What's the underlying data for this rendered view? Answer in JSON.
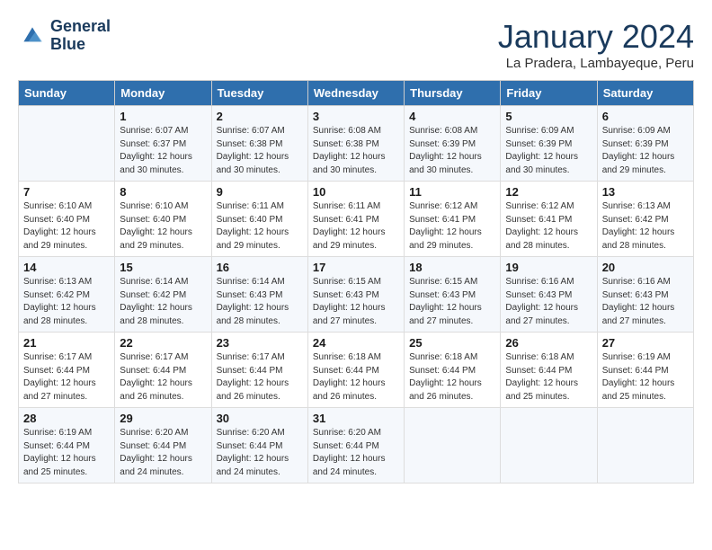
{
  "header": {
    "logo_line1": "General",
    "logo_line2": "Blue",
    "month": "January 2024",
    "location": "La Pradera, Lambayeque, Peru"
  },
  "days_of_week": [
    "Sunday",
    "Monday",
    "Tuesday",
    "Wednesday",
    "Thursday",
    "Friday",
    "Saturday"
  ],
  "weeks": [
    [
      {
        "day": "",
        "sunrise": "",
        "sunset": "",
        "daylight": ""
      },
      {
        "day": "1",
        "sunrise": "6:07 AM",
        "sunset": "6:37 PM",
        "daylight": "12 hours and 30 minutes."
      },
      {
        "day": "2",
        "sunrise": "6:07 AM",
        "sunset": "6:38 PM",
        "daylight": "12 hours and 30 minutes."
      },
      {
        "day": "3",
        "sunrise": "6:08 AM",
        "sunset": "6:38 PM",
        "daylight": "12 hours and 30 minutes."
      },
      {
        "day": "4",
        "sunrise": "6:08 AM",
        "sunset": "6:39 PM",
        "daylight": "12 hours and 30 minutes."
      },
      {
        "day": "5",
        "sunrise": "6:09 AM",
        "sunset": "6:39 PM",
        "daylight": "12 hours and 30 minutes."
      },
      {
        "day": "6",
        "sunrise": "6:09 AM",
        "sunset": "6:39 PM",
        "daylight": "12 hours and 29 minutes."
      }
    ],
    [
      {
        "day": "7",
        "sunrise": "6:10 AM",
        "sunset": "6:40 PM",
        "daylight": "12 hours and 29 minutes."
      },
      {
        "day": "8",
        "sunrise": "6:10 AM",
        "sunset": "6:40 PM",
        "daylight": "12 hours and 29 minutes."
      },
      {
        "day": "9",
        "sunrise": "6:11 AM",
        "sunset": "6:40 PM",
        "daylight": "12 hours and 29 minutes."
      },
      {
        "day": "10",
        "sunrise": "6:11 AM",
        "sunset": "6:41 PM",
        "daylight": "12 hours and 29 minutes."
      },
      {
        "day": "11",
        "sunrise": "6:12 AM",
        "sunset": "6:41 PM",
        "daylight": "12 hours and 29 minutes."
      },
      {
        "day": "12",
        "sunrise": "6:12 AM",
        "sunset": "6:41 PM",
        "daylight": "12 hours and 28 minutes."
      },
      {
        "day": "13",
        "sunrise": "6:13 AM",
        "sunset": "6:42 PM",
        "daylight": "12 hours and 28 minutes."
      }
    ],
    [
      {
        "day": "14",
        "sunrise": "6:13 AM",
        "sunset": "6:42 PM",
        "daylight": "12 hours and 28 minutes."
      },
      {
        "day": "15",
        "sunrise": "6:14 AM",
        "sunset": "6:42 PM",
        "daylight": "12 hours and 28 minutes."
      },
      {
        "day": "16",
        "sunrise": "6:14 AM",
        "sunset": "6:43 PM",
        "daylight": "12 hours and 28 minutes."
      },
      {
        "day": "17",
        "sunrise": "6:15 AM",
        "sunset": "6:43 PM",
        "daylight": "12 hours and 27 minutes."
      },
      {
        "day": "18",
        "sunrise": "6:15 AM",
        "sunset": "6:43 PM",
        "daylight": "12 hours and 27 minutes."
      },
      {
        "day": "19",
        "sunrise": "6:16 AM",
        "sunset": "6:43 PM",
        "daylight": "12 hours and 27 minutes."
      },
      {
        "day": "20",
        "sunrise": "6:16 AM",
        "sunset": "6:43 PM",
        "daylight": "12 hours and 27 minutes."
      }
    ],
    [
      {
        "day": "21",
        "sunrise": "6:17 AM",
        "sunset": "6:44 PM",
        "daylight": "12 hours and 27 minutes."
      },
      {
        "day": "22",
        "sunrise": "6:17 AM",
        "sunset": "6:44 PM",
        "daylight": "12 hours and 26 minutes."
      },
      {
        "day": "23",
        "sunrise": "6:17 AM",
        "sunset": "6:44 PM",
        "daylight": "12 hours and 26 minutes."
      },
      {
        "day": "24",
        "sunrise": "6:18 AM",
        "sunset": "6:44 PM",
        "daylight": "12 hours and 26 minutes."
      },
      {
        "day": "25",
        "sunrise": "6:18 AM",
        "sunset": "6:44 PM",
        "daylight": "12 hours and 26 minutes."
      },
      {
        "day": "26",
        "sunrise": "6:18 AM",
        "sunset": "6:44 PM",
        "daylight": "12 hours and 25 minutes."
      },
      {
        "day": "27",
        "sunrise": "6:19 AM",
        "sunset": "6:44 PM",
        "daylight": "12 hours and 25 minutes."
      }
    ],
    [
      {
        "day": "28",
        "sunrise": "6:19 AM",
        "sunset": "6:44 PM",
        "daylight": "12 hours and 25 minutes."
      },
      {
        "day": "29",
        "sunrise": "6:20 AM",
        "sunset": "6:44 PM",
        "daylight": "12 hours and 24 minutes."
      },
      {
        "day": "30",
        "sunrise": "6:20 AM",
        "sunset": "6:44 PM",
        "daylight": "12 hours and 24 minutes."
      },
      {
        "day": "31",
        "sunrise": "6:20 AM",
        "sunset": "6:44 PM",
        "daylight": "12 hours and 24 minutes."
      },
      {
        "day": "",
        "sunrise": "",
        "sunset": "",
        "daylight": ""
      },
      {
        "day": "",
        "sunrise": "",
        "sunset": "",
        "daylight": ""
      },
      {
        "day": "",
        "sunrise": "",
        "sunset": "",
        "daylight": ""
      }
    ]
  ]
}
